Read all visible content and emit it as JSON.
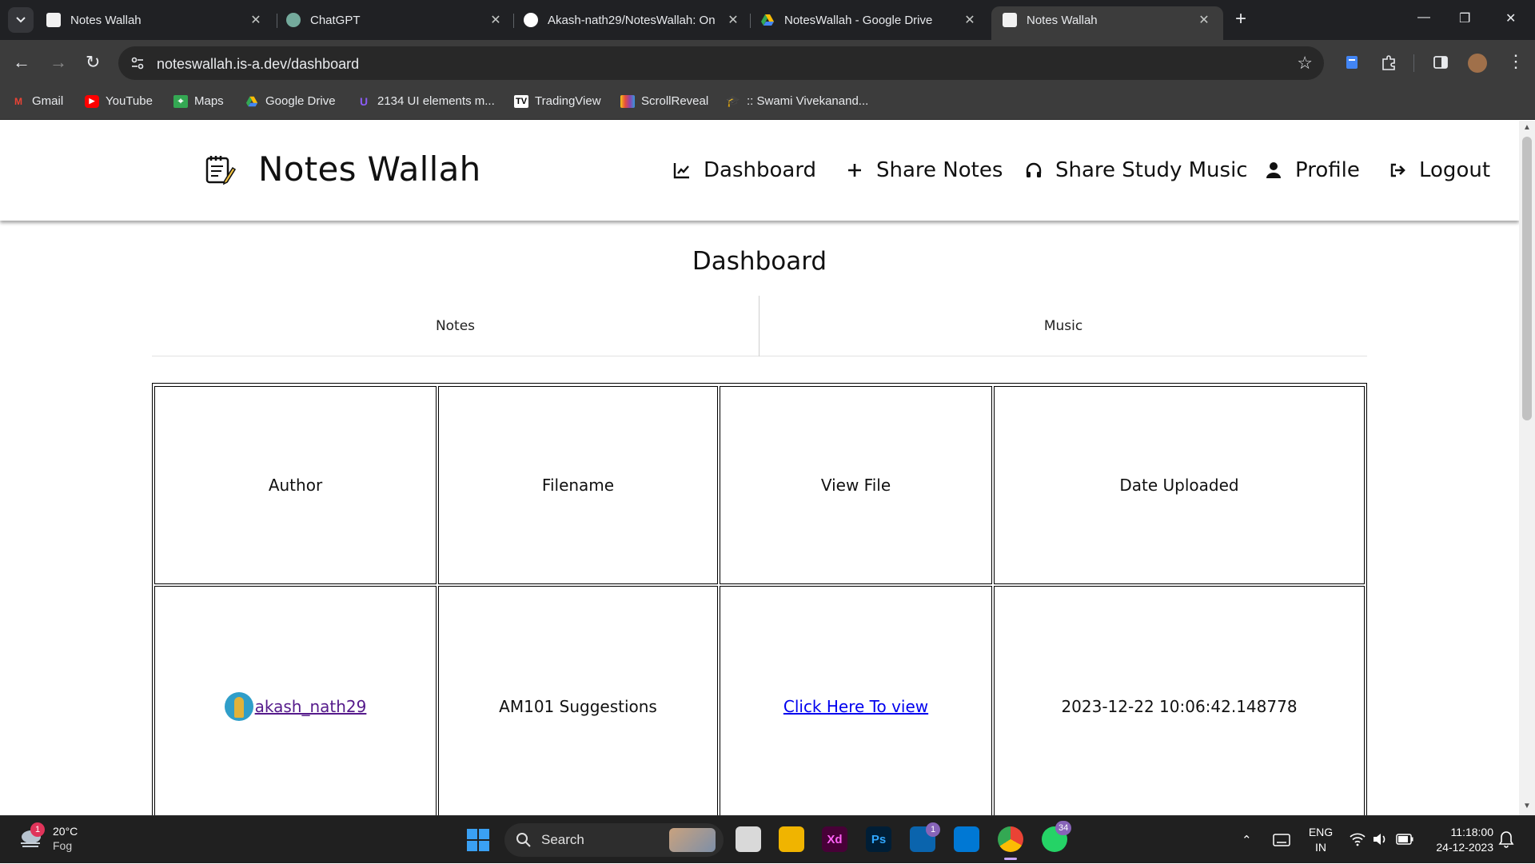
{
  "browser": {
    "tabs": [
      {
        "title": "Notes Wallah",
        "favicon": "notes-wallah-icon",
        "active": false
      },
      {
        "title": "ChatGPT",
        "favicon": "chatgpt-icon",
        "active": false
      },
      {
        "title": "Akash-nath29/NotesWallah: On",
        "favicon": "github-icon",
        "active": false
      },
      {
        "title": "NotesWallah - Google Drive",
        "favicon": "google-drive-icon",
        "active": false
      },
      {
        "title": "Notes Wallah",
        "favicon": "notes-wallah-icon",
        "active": true
      }
    ],
    "close_glyph": "✕",
    "new_tab_glyph": "+",
    "url": "noteswallah.is-a.dev/dashboard",
    "bookmarks": [
      {
        "label": "Gmail",
        "icon": "gmail-icon",
        "color": "#ea4335"
      },
      {
        "label": "YouTube",
        "icon": "youtube-icon",
        "color": "#ff0000"
      },
      {
        "label": "Maps",
        "icon": "maps-icon",
        "color": "#34a853"
      },
      {
        "label": "Google Drive",
        "icon": "google-drive-icon",
        "color": "#fbbc04"
      },
      {
        "label": "2134 UI elements m...",
        "icon": "uiverse-icon",
        "color": "#8b5cf6"
      },
      {
        "label": "TradingView",
        "icon": "tradingview-icon",
        "color": "#ffffff"
      },
      {
        "label": "ScrollReveal",
        "icon": "scrollreveal-icon",
        "color": "#f5c518"
      },
      {
        "label": ":: Swami Vivekanand...",
        "icon": "graduation-cap-icon",
        "color": "#6b8cce"
      }
    ]
  },
  "site": {
    "brand": "Notes Wallah",
    "nav": [
      {
        "label": "Dashboard",
        "icon": "chart-line-icon"
      },
      {
        "label": "Share Notes",
        "icon": "plus-icon"
      },
      {
        "label": "Share Study Music",
        "icon": "headphones-icon"
      },
      {
        "label": "Profile",
        "icon": "user-icon"
      },
      {
        "label": "Logout",
        "icon": "sign-out-icon"
      }
    ],
    "page_title": "Dashboard",
    "tabs": [
      "Notes",
      "Music"
    ],
    "table": {
      "headers": [
        "Author",
        "Filename",
        "View File",
        "Date Uploaded"
      ],
      "rows": [
        {
          "author": "akash_nath29",
          "filename": "AM101 Suggestions",
          "view": "Click Here To view",
          "date": "2023-12-22 10:06:42.148778"
        }
      ]
    }
  },
  "taskbar": {
    "weather_temp": "20°C",
    "weather_cond": "Fog",
    "weather_badge": "1",
    "search_label": "Search",
    "apps": [
      {
        "name": "file-explorer-icon",
        "label": ""
      },
      {
        "name": "adobe-xd-icon",
        "label": "Xd"
      },
      {
        "name": "photoshop-icon",
        "label": "Ps"
      },
      {
        "name": "mail-icon",
        "label": "",
        "badge": "1"
      },
      {
        "name": "vscode-icon",
        "label": ""
      },
      {
        "name": "chrome-icon",
        "label": ""
      },
      {
        "name": "whatsapp-icon",
        "label": "",
        "badge": "34"
      }
    ],
    "lang_top": "ENG",
    "lang_bottom": "IN",
    "time": "11:18:00",
    "date": "24-12-2023"
  }
}
